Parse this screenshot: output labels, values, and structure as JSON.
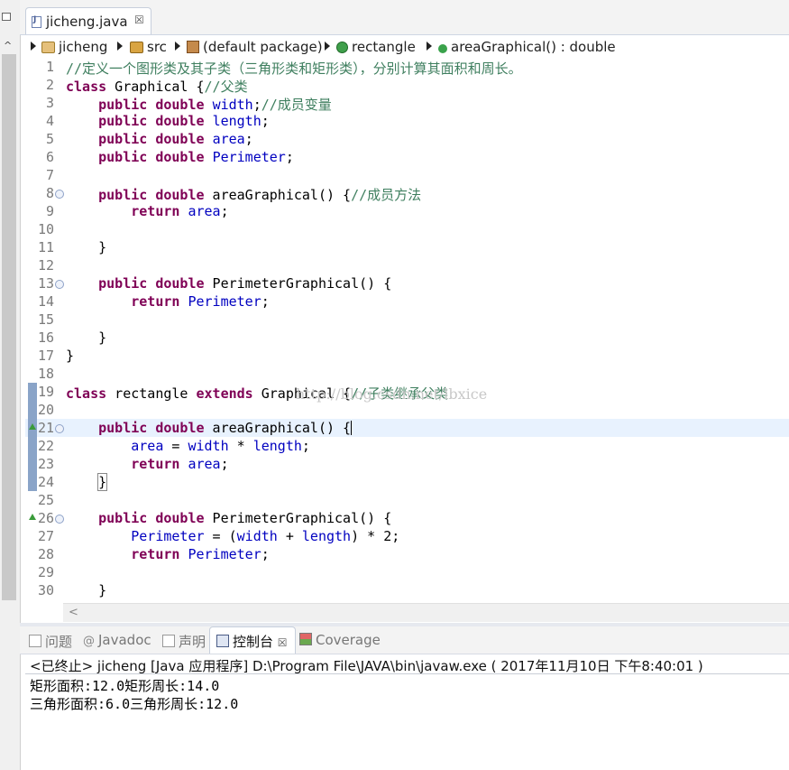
{
  "editor_tab": {
    "title": "jicheng.java",
    "close": "☒"
  },
  "breadcrumb": [
    {
      "label": "jicheng",
      "icon": "project-icon"
    },
    {
      "label": "src",
      "icon": "source-folder-icon"
    },
    {
      "label": "(default package)",
      "icon": "package-icon"
    },
    {
      "label": "rectangle",
      "icon": "class-icon"
    },
    {
      "label": "areaGraphical() : double",
      "icon": "method-icon"
    }
  ],
  "code": {
    "lines": [
      {
        "n": "1",
        "text": "//定义一个图形类及其子类（三角形类和矩形类），分别计算其面积和周长。"
      },
      {
        "n": "2",
        "text": "class Graphical {//父类"
      },
      {
        "n": "3",
        "text": "    public double width;//成员变量"
      },
      {
        "n": "4",
        "text": "    public double length;"
      },
      {
        "n": "5",
        "text": "    public double area;"
      },
      {
        "n": "6",
        "text": "    public double Perimeter;"
      },
      {
        "n": "7",
        "text": ""
      },
      {
        "n": "8",
        "text": "    public double areaGraphical() {//成员方法"
      },
      {
        "n": "9",
        "text": "        return area;"
      },
      {
        "n": "10",
        "text": ""
      },
      {
        "n": "11",
        "text": "    }"
      },
      {
        "n": "12",
        "text": ""
      },
      {
        "n": "13",
        "text": "    public double PerimeterGraphical() {"
      },
      {
        "n": "14",
        "text": "        return Perimeter;"
      },
      {
        "n": "15",
        "text": ""
      },
      {
        "n": "16",
        "text": "    }"
      },
      {
        "n": "17",
        "text": "}"
      },
      {
        "n": "18",
        "text": ""
      },
      {
        "n": "19",
        "text": "class rectangle extends Graphical {//子类继承父类"
      },
      {
        "n": "20",
        "text": ""
      },
      {
        "n": "21",
        "text": "    public double areaGraphical() {"
      },
      {
        "n": "22",
        "text": "        area = width * length;"
      },
      {
        "n": "23",
        "text": "        return area;"
      },
      {
        "n": "24",
        "text": "    }"
      },
      {
        "n": "25",
        "text": ""
      },
      {
        "n": "26",
        "text": "    public double PerimeterGraphical() {"
      },
      {
        "n": "27",
        "text": "        Perimeter = (width + length) * 2;"
      },
      {
        "n": "28",
        "text": "        return Perimeter;"
      },
      {
        "n": "29",
        "text": ""
      },
      {
        "n": "30",
        "text": "    }"
      }
    ],
    "watermark": "http://blog.csdn.net/lbxice"
  },
  "panel_tabs": [
    {
      "label": "问题",
      "active": false
    },
    {
      "label": "Javadoc",
      "active": false
    },
    {
      "label": "声明",
      "active": false
    },
    {
      "label": "控制台",
      "active": true,
      "close": "☒"
    },
    {
      "label": "Coverage",
      "active": false
    }
  ],
  "console": {
    "header": "<已终止> jicheng [Java 应用程序] D:\\Program File\\JAVA\\bin\\javaw.exe ( 2017年11月10日 下午8:40:01 )",
    "output": [
      "矩形面积:12.0矩形周长:14.0",
      "三角形面积:6.0三角形周长:12.0"
    ]
  },
  "colors": {
    "keyword": "#7f0055",
    "comment": "#3f7f5f",
    "field": "#0000c0",
    "current_line": "#e8f2fe"
  }
}
